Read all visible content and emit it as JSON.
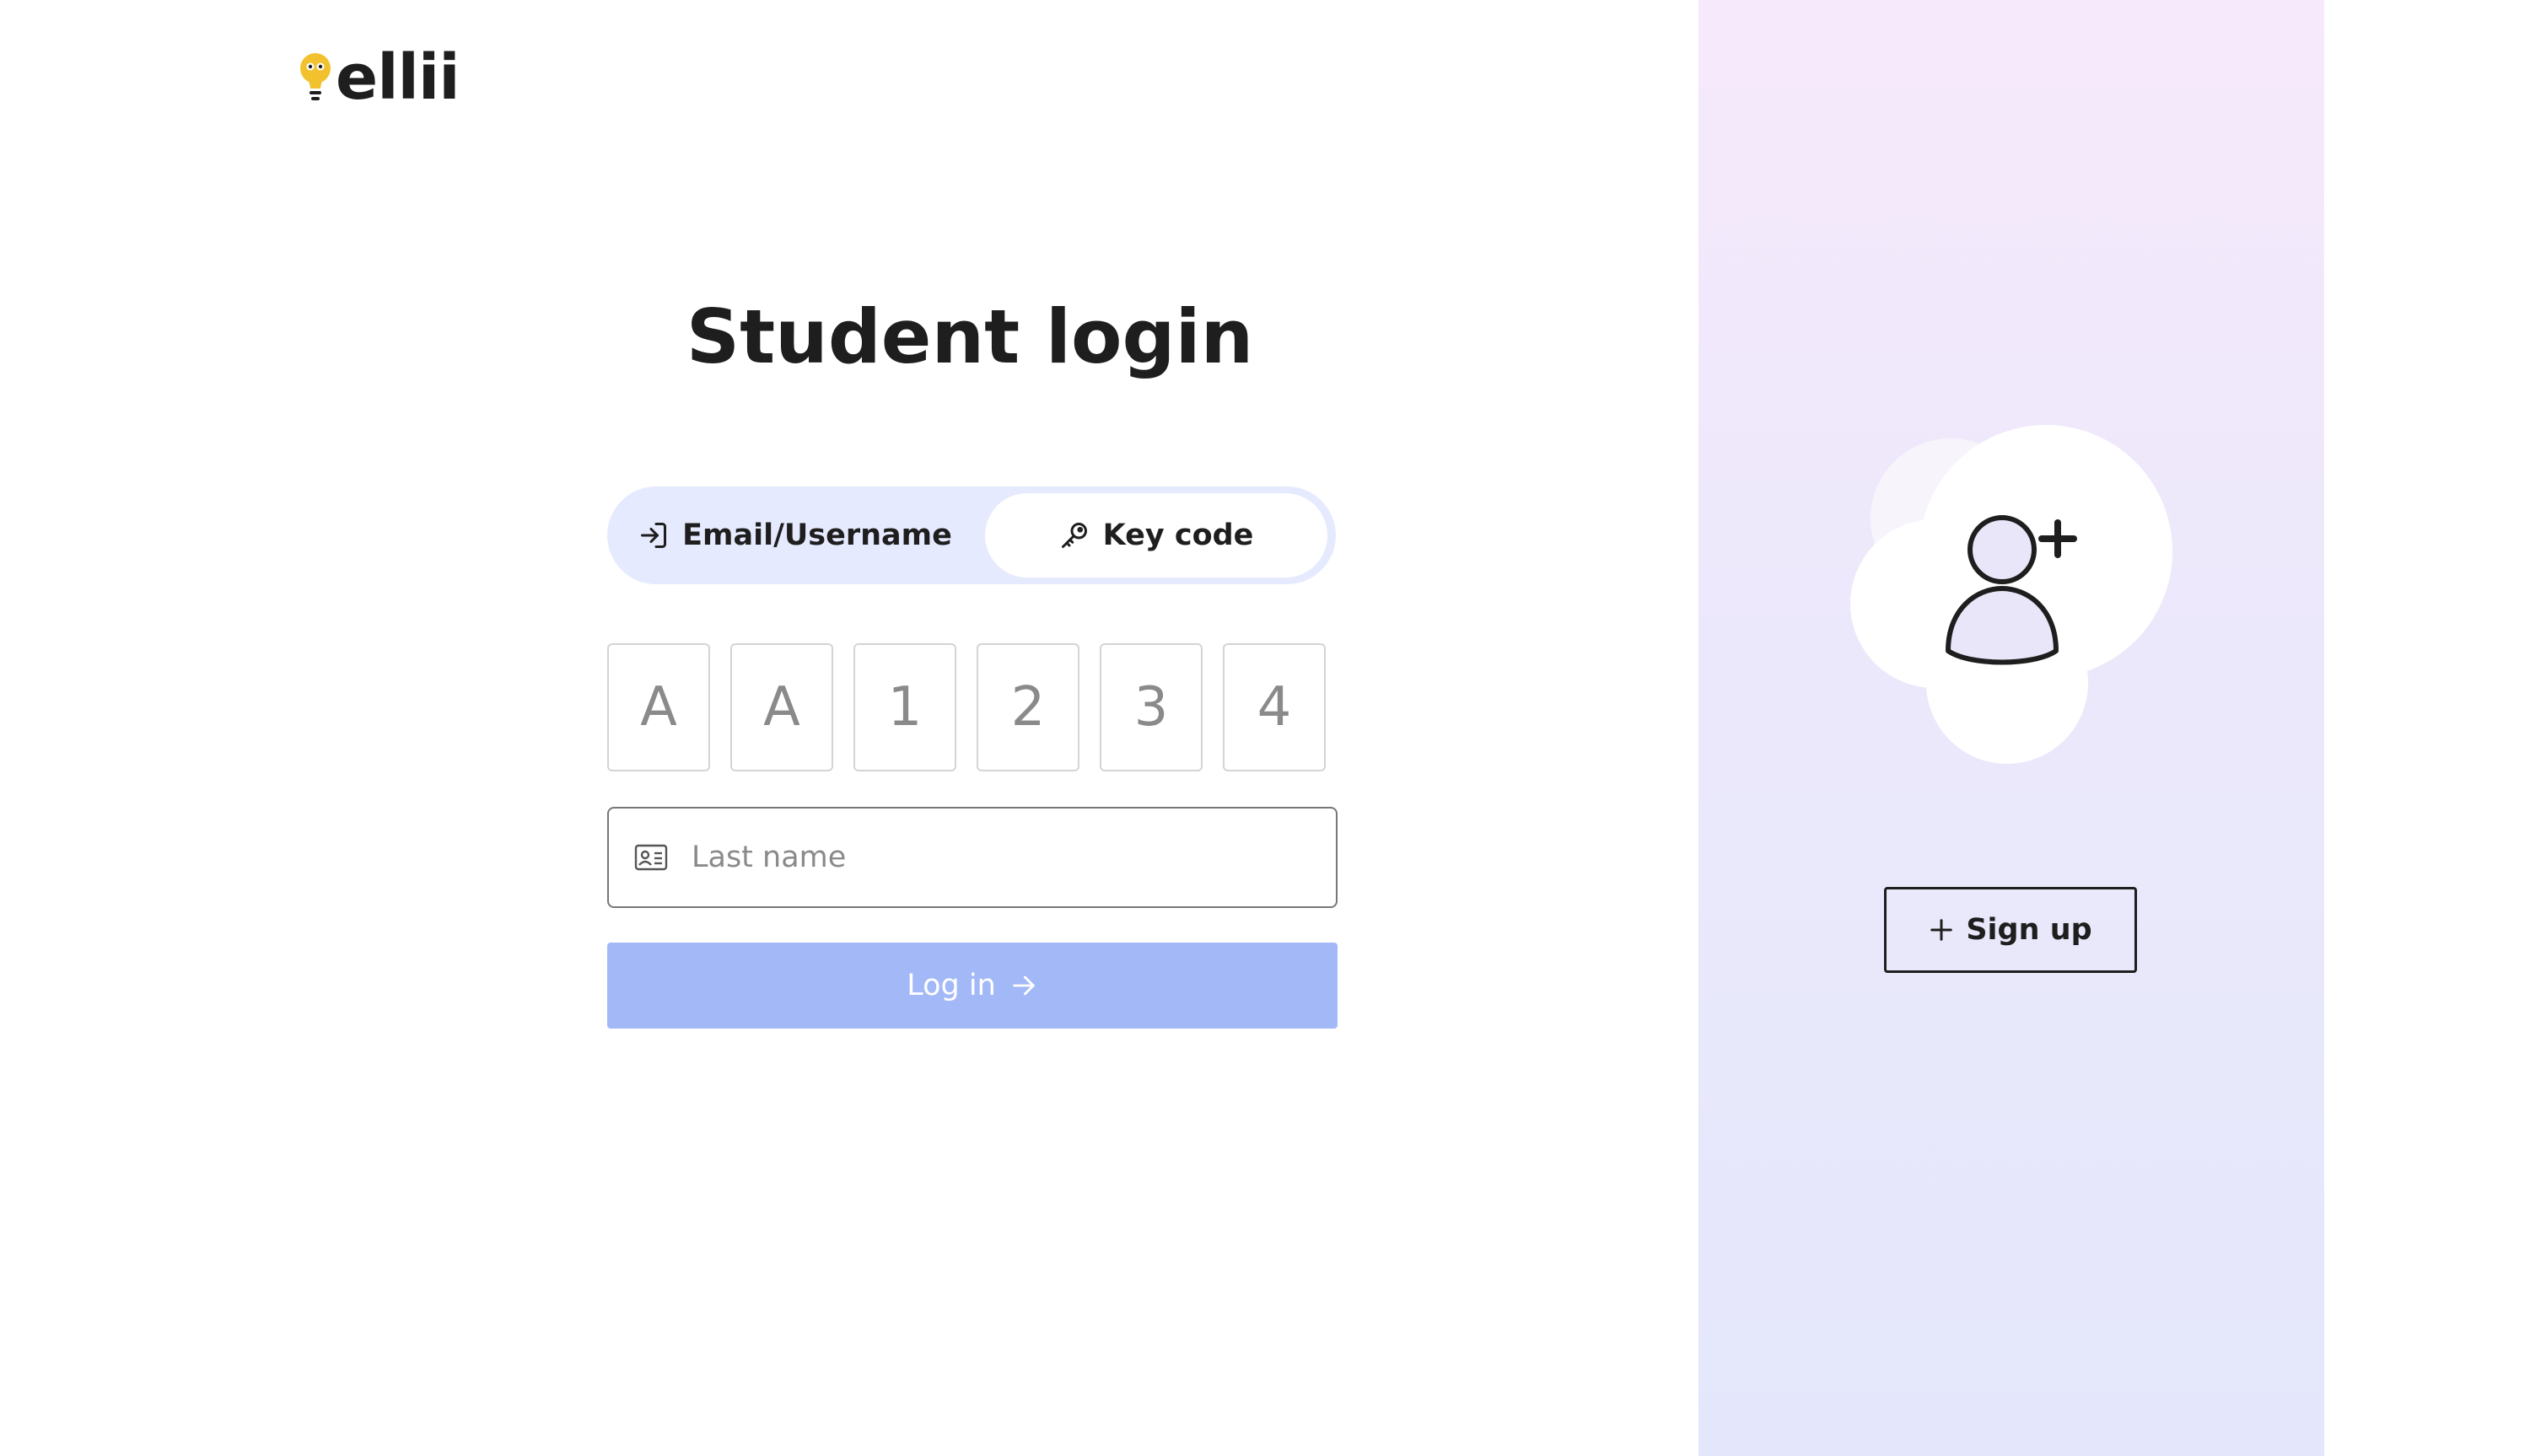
{
  "logo": {
    "text": "ellii",
    "icon": "lightbulb-icon",
    "accent_color": "#f2c12e"
  },
  "login": {
    "title": "Student login",
    "tabs": [
      {
        "label": "Email/Username",
        "icon": "sign-in-arrow-icon",
        "selected": false
      },
      {
        "label": "Key code",
        "icon": "key-icon",
        "selected": true
      }
    ],
    "key_code_placeholders": [
      "A",
      "A",
      "1",
      "2",
      "3",
      "4"
    ],
    "last_name": {
      "placeholder": "Last name",
      "value": "",
      "icon": "id-card-icon"
    },
    "submit": {
      "label": "Log in",
      "icon": "arrow-right-icon",
      "color": "#a3b8f7",
      "disabled": true
    }
  },
  "signup": {
    "illustration_icon": "add-user-icon",
    "button_label": "Sign up",
    "button_icon": "plus-icon"
  },
  "colors": {
    "tab_track": "#e6eafe",
    "panel_gradient_top": "#f6e9fb",
    "panel_gradient_bottom": "#e4e7fb",
    "text": "#1e1e1e"
  }
}
